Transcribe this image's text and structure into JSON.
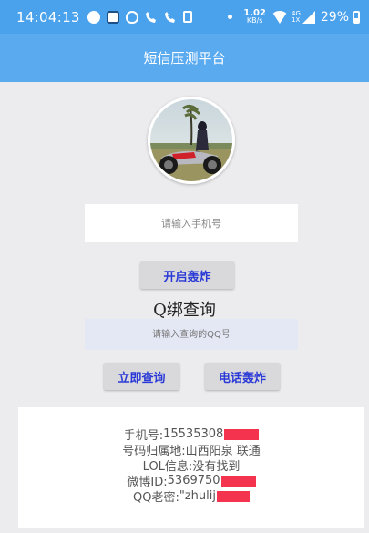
{
  "status_bar": {
    "time": "14:04:13",
    "net_speed_value": "1.02",
    "net_speed_unit": "KB/s",
    "net_type_top": "4G",
    "net_type_bottom": "1X",
    "battery": "29%",
    "icons": [
      "message-icon",
      "robot-app-icon",
      "qq-icon",
      "missed-call-icon",
      "missed-call-icon",
      "doc-icon",
      "wifi-icon",
      "signal-icon",
      "battery-icon"
    ]
  },
  "app_bar": {
    "title": "短信压测平台"
  },
  "avatar": {
    "alt": "motorcycle-rider-avatar"
  },
  "phone_section": {
    "placeholder": "请输入手机号",
    "button_label": "开启轰炸"
  },
  "qq_section": {
    "title": "Q绑查询",
    "placeholder": "请输入查询的QQ号",
    "query_button_label": "立即查询",
    "call_button_label": "电话轰炸"
  },
  "result": {
    "lines": [
      {
        "label": "手机号:",
        "value": "15535308",
        "redacted": true
      },
      {
        "label": "号码归属地:",
        "value": "山西阳泉 联通",
        "redacted": false
      },
      {
        "label": "LOL信息:",
        "value": "没有找到",
        "redacted": false
      },
      {
        "label": "微博ID:",
        "value": "5369750",
        "redacted": true
      },
      {
        "label": "QQ老密:",
        "value": "\"zhulij",
        "redacted": true
      }
    ]
  },
  "colors": {
    "status_bar": "#4aa2ec",
    "app_bar": "#5aaaf0",
    "button_text": "#2b3ad6",
    "redaction": "#f4334e"
  }
}
